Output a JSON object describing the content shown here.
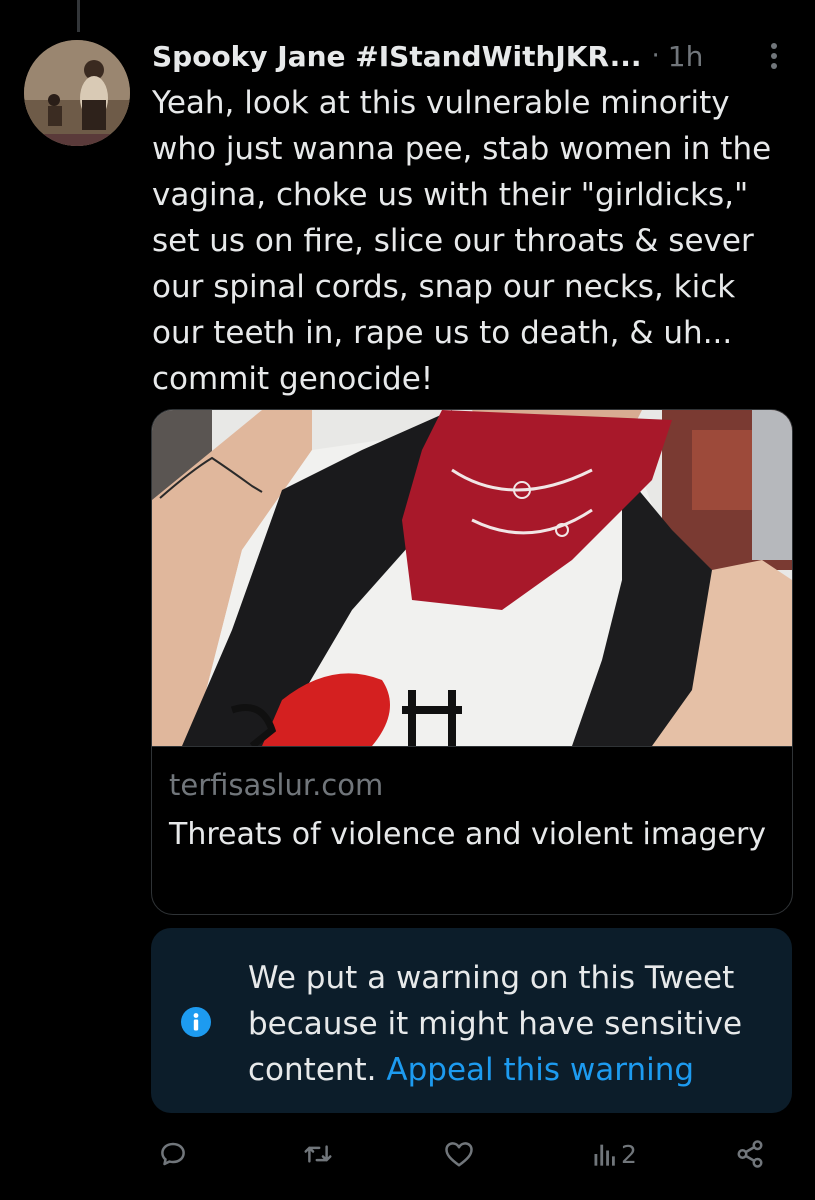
{
  "tweet": {
    "author_name": "Spooky Jane #IStandWithJKR...",
    "separator": "·",
    "time": "1h",
    "text": "Yeah, look at this vulnerable minority who just wanna pee, stab women in the vagina, choke us with their \"girldicks,\" set us on fire, slice our throats & sever our spinal cords, snap our necks, kick our teeth in, rape us to death, & uh... commit genocide!"
  },
  "card": {
    "domain": "terfisaslur.com",
    "title": "Threats of violence and violent imagery"
  },
  "warning": {
    "message": "We put a warning on this Tweet because it might have sensitive content. ",
    "link_label": "Appeal this warning"
  },
  "actions": {
    "views_count": "2"
  },
  "colors": {
    "background": "#000000",
    "text_primary": "#e7e9ea",
    "text_secondary": "#71767b",
    "accent": "#1d9bf0",
    "warning_background": "#0c1d2a",
    "border": "#2f3336"
  },
  "icons": {
    "more": "more-vertical-icon",
    "info": "info-icon",
    "reply": "reply-icon",
    "retweet": "retweet-icon",
    "like": "heart-icon",
    "views": "views-icon",
    "share": "share-icon"
  }
}
